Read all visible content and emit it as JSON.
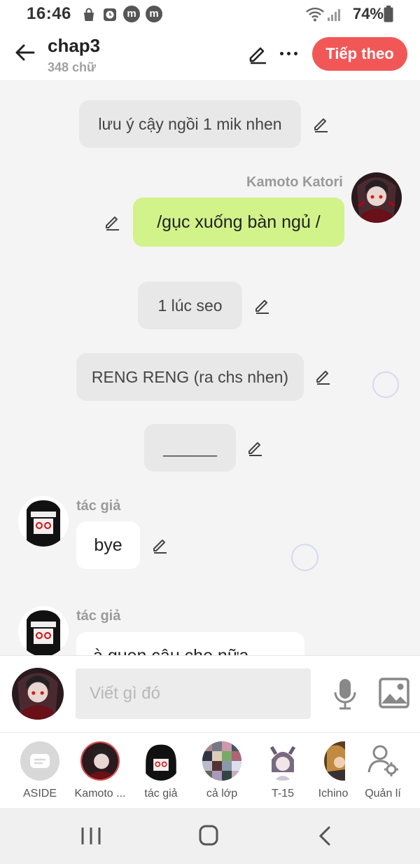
{
  "status_bar": {
    "time": "16:46",
    "battery": "74%",
    "notification_icons": [
      "shopping-bag-icon",
      "clock-app-icon",
      "m-app-icon",
      "m-app-icon"
    ]
  },
  "header": {
    "title": "chap3",
    "subtitle": "348 chữ",
    "next_label": "Tiếp theo",
    "accent_color": "#f25757"
  },
  "messages": [
    {
      "type": "narration",
      "text": "lưu ý cậy ngồi 1 mik nhen"
    },
    {
      "type": "character",
      "speaker": "Kamoto Katori",
      "text": "/gục xuống bàn ngủ /",
      "bubble_color": "#d2f28a"
    },
    {
      "type": "narration",
      "text": "1 lúc seo"
    },
    {
      "type": "narration",
      "text": "RENG RENG (ra chs nhen)"
    },
    {
      "type": "narration",
      "text": "______"
    },
    {
      "type": "author",
      "speaker": "tác giả",
      "text": "bye"
    },
    {
      "type": "author",
      "speaker": "tác giả",
      "text": "à quen cậu che nữa"
    }
  ],
  "composer": {
    "placeholder": "Viết gì đó"
  },
  "characters": [
    {
      "label": "ASIDE",
      "icon": "aside-chat-icon"
    },
    {
      "label": "Kamoto ..."
    },
    {
      "label": "tác giả"
    },
    {
      "label": "cả lớp"
    },
    {
      "label": "T-15"
    },
    {
      "label": "Ichino"
    },
    {
      "label": "Quản lí",
      "icon": "user-settings-icon"
    }
  ]
}
